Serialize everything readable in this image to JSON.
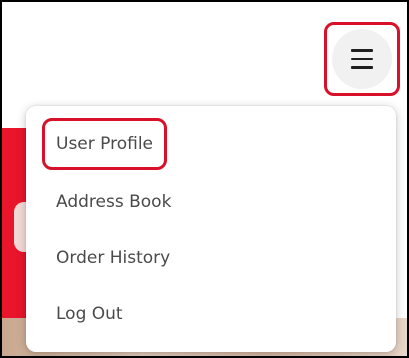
{
  "header": {
    "menu_toggle_icon": "hamburger-icon"
  },
  "dropdown": {
    "items": [
      {
        "label": "User Profile",
        "highlighted": true
      },
      {
        "label": "Address Book",
        "highlighted": false
      },
      {
        "label": "Order History",
        "highlighted": false
      },
      {
        "label": "Log Out",
        "highlighted": false
      }
    ]
  },
  "colors": {
    "highlight_border": "#d8102a",
    "brand_red": "#e8152b",
    "menu_text": "#4a4a4a",
    "toggle_background": "#f1f1f1"
  }
}
